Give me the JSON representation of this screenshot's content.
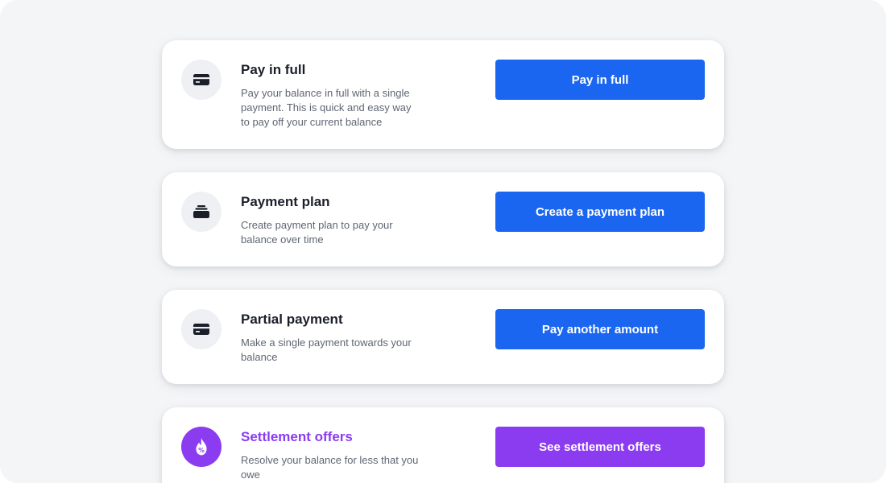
{
  "colors": {
    "background": "#f4f5f7",
    "card": "#ffffff",
    "primary_button": "#1a66f0",
    "settlement_accent": "#8b3cf0",
    "icon_circle": "#eef0f3",
    "title_text": "#1b1f2a",
    "description_text": "#5f6673"
  },
  "options": [
    {
      "icon": "credit-card-icon",
      "title": "Pay in full",
      "description": "Pay your balance in full with a single payment. This is quick and easy way to pay off your current balance",
      "button_label": "Pay in full"
    },
    {
      "icon": "stacked-cards-icon",
      "title": "Payment plan",
      "description": "Create payment plan to pay your balance over time",
      "button_label": "Create a payment plan"
    },
    {
      "icon": "credit-card-icon",
      "title": "Partial payment",
      "description": "Make a single payment towards your balance",
      "button_label": "Pay another amount"
    },
    {
      "icon": "discount-flame-icon",
      "title": "Settlement offers",
      "description": "Resolve your balance for less that you owe",
      "button_label": "See settlement offers"
    }
  ]
}
